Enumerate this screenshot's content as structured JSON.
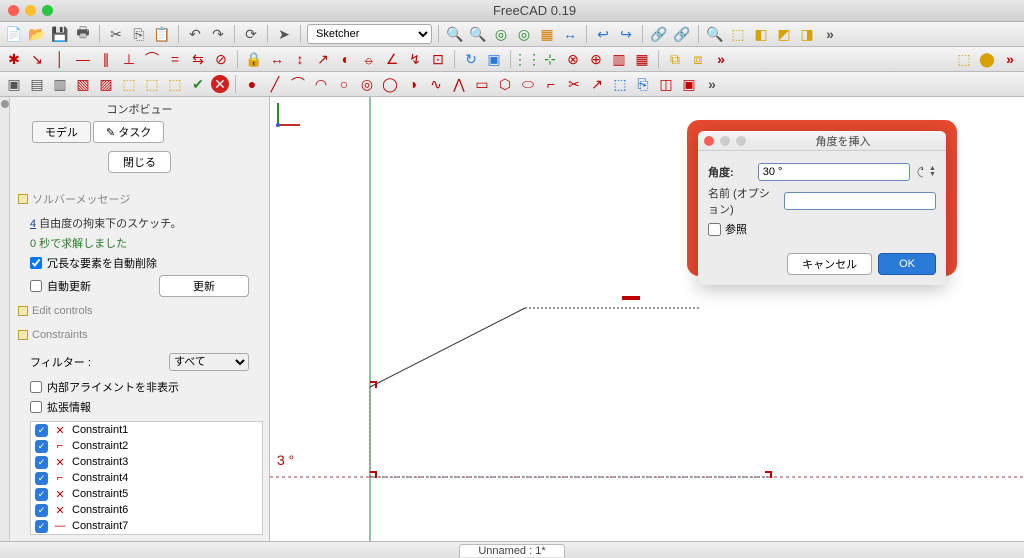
{
  "app_title": "FreeCAD 0.19",
  "workbench_selected": "Sketcher",
  "sidebar": {
    "title": "コンボビュー",
    "tabs": {
      "model": "モデル",
      "task": "タスク"
    },
    "close_btn": "閉じる",
    "solver_label": "ソルバーメッセージ",
    "dof_prefix": "4",
    "dof_text": " 自由度の拘束下のスケッチ。",
    "solved_text": "0 秒で求解しました",
    "auto_remove": "冗長な要素を自動削除",
    "auto_update": "自動更新",
    "update_btn": "更新",
    "edit_controls": "Edit controls",
    "constraints_title": "Constraints",
    "filter_label": "フィルター :",
    "filter_value": "すべて",
    "hide_internal": "内部アライメントを非表示",
    "ext_info": "拡張情報",
    "constraints": [
      {
        "icon": "✕",
        "label": "Constraint1"
      },
      {
        "icon": "⌐",
        "label": "Constraint2"
      },
      {
        "icon": "✕",
        "label": "Constraint3"
      },
      {
        "icon": "⌐",
        "label": "Constraint4"
      },
      {
        "icon": "✕",
        "label": "Constraint5"
      },
      {
        "icon": "✕",
        "label": "Constraint6"
      },
      {
        "icon": "—",
        "label": "Constraint7"
      }
    ]
  },
  "dialog": {
    "title": "角度を挿入",
    "angle_label": "角度:",
    "angle_value": "30 °",
    "name_label": "名前 (オプション)",
    "name_value": "",
    "ref_label": "参照",
    "cancel": "キャンセル",
    "ok": "OK"
  },
  "canvas": {
    "angle_readout": "3 °"
  },
  "statusbar": {
    "document": "Unnamed : 1*"
  }
}
